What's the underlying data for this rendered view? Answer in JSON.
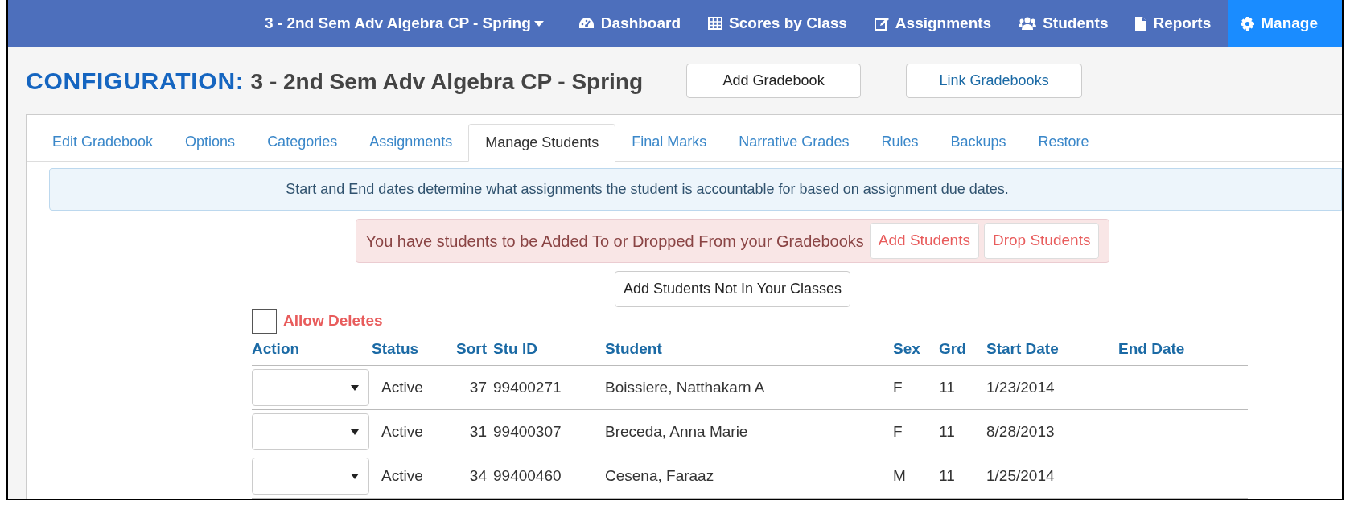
{
  "nav": {
    "course": "3 - 2nd Sem Adv Algebra CP - Spring",
    "items": [
      {
        "label": "Dashboard",
        "kind": "gauge",
        "selected": false
      },
      {
        "label": "Scores by Class",
        "kind": "table",
        "selected": false
      },
      {
        "label": "Assignments",
        "kind": "edit",
        "selected": false
      },
      {
        "label": "Students",
        "kind": "users",
        "selected": false
      },
      {
        "label": "Reports",
        "kind": "file",
        "selected": false
      },
      {
        "label": "Manage",
        "kind": "gear",
        "selected": true
      }
    ]
  },
  "header": {
    "label": "CONFIGURATION:",
    "course": "3 - 2nd Sem Adv Algebra CP - Spring",
    "buttons": [
      {
        "label": "Add Gradebook",
        "kind": "default"
      },
      {
        "label": "Link Gradebooks",
        "kind": "link"
      }
    ]
  },
  "tabs": [
    {
      "label": "Edit Gradebook",
      "selected": false
    },
    {
      "label": "Options",
      "selected": false
    },
    {
      "label": "Categories",
      "selected": false
    },
    {
      "label": "Assignments",
      "selected": false
    },
    {
      "label": "Manage Students",
      "selected": true
    },
    {
      "label": "Final Marks",
      "selected": false
    },
    {
      "label": "Narrative Grades",
      "selected": false
    },
    {
      "label": "Rules",
      "selected": false
    },
    {
      "label": "Backups",
      "selected": false
    },
    {
      "label": "Restore",
      "selected": false
    }
  ],
  "info": "Start and End dates determine what assignments the student is accountable for based on assignment due dates.",
  "warning": {
    "text": "You have students to be Added To or Dropped From your Gradebooks",
    "buttons": [
      "Add Students",
      "Drop Students"
    ]
  },
  "add_other_button": "Add Students Not In Your Classes",
  "allow_deletes": {
    "label": "Allow Deletes",
    "checked": false
  },
  "table": {
    "columns": [
      "Action",
      "Status",
      "Sort",
      "Stu ID",
      "Student",
      "Sex",
      "Grd",
      "Start Date",
      "End Date"
    ],
    "rows": [
      {
        "status": "Active",
        "sort": "37",
        "stu_id": "99400271",
        "student": "Boissiere, Natthakarn A",
        "sex": "F",
        "grd": "11",
        "start_date": "1/23/2014"
      },
      {
        "status": "Active",
        "sort": "31",
        "stu_id": "99400307",
        "student": "Breceda, Anna Marie",
        "sex": "F",
        "grd": "11",
        "start_date": "8/28/2013"
      },
      {
        "status": "Active",
        "sort": "34",
        "stu_id": "99400460",
        "student": "Cesena, Faraaz",
        "sex": "M",
        "grd": "11",
        "start_date": "1/25/2014"
      }
    ]
  }
}
